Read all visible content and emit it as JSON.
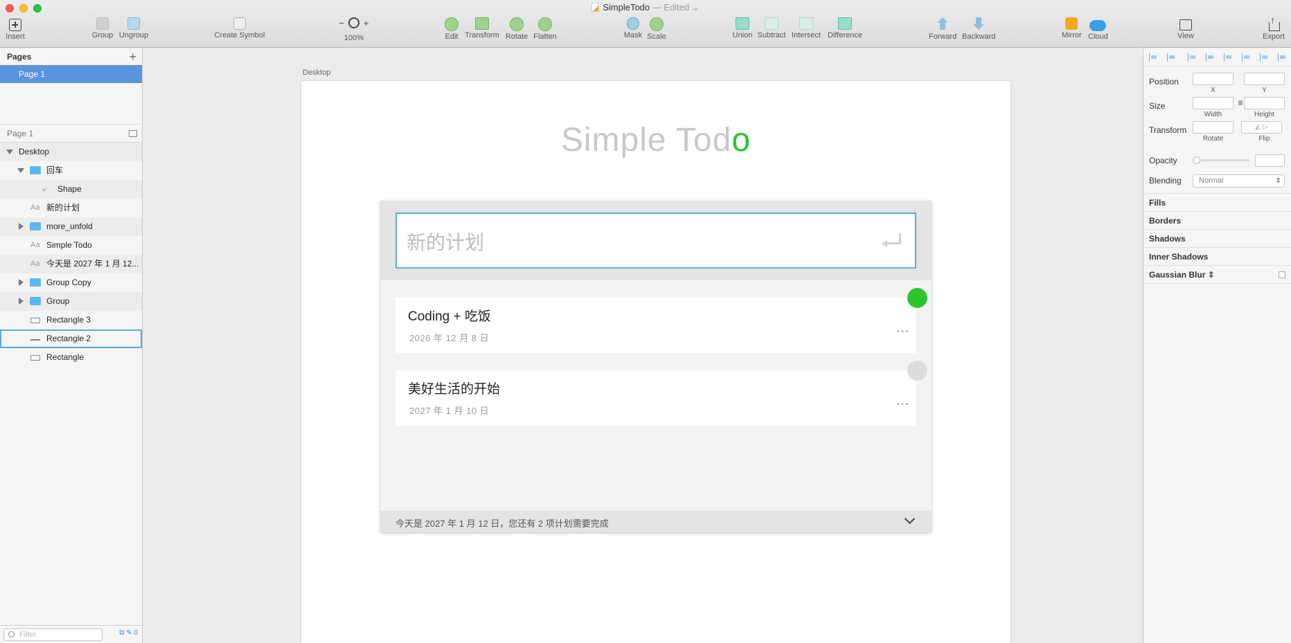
{
  "window": {
    "title": "SimpleTodo",
    "edited": "— Edited ⌄"
  },
  "toolbar": {
    "insert": "Insert",
    "group": "Group",
    "ungroup": "Ungroup",
    "create_symbol": "Create Symbol",
    "zoom_minus": "−",
    "zoom_plus": "+",
    "zoom_value": "100%",
    "edit": "Edit",
    "transform": "Transform",
    "rotate": "Rotate",
    "flatten": "Flatten",
    "mask": "Mask",
    "scale": "Scale",
    "union": "Union",
    "subtract": "Subtract",
    "intersect": "Intersect",
    "difference": "Difference",
    "forward": "Forward",
    "backward": "Backward",
    "mirror": "Mirror",
    "cloud": "Cloud",
    "view": "View",
    "export": "Export"
  },
  "sidebar": {
    "pages_header": "Pages",
    "add_page": "+",
    "pages": [
      "Page 1"
    ],
    "layers_header": "Page 1",
    "layers": [
      {
        "name": "Desktop"
      },
      {
        "name": "回车"
      },
      {
        "name": "Shape"
      },
      {
        "name": "新的计划"
      },
      {
        "name": "more_unfold"
      },
      {
        "name": "Simple Todo"
      },
      {
        "name": "今天是 2027 年 1 月 12..."
      },
      {
        "name": "Group Copy"
      },
      {
        "name": "Group"
      },
      {
        "name": "Rectangle 3"
      },
      {
        "name": "Rectangle 2"
      },
      {
        "name": "Rectangle"
      }
    ],
    "layer_text_icon": "Aa",
    "layer_shape_icon": "⤶",
    "filter_placeholder": "Filter",
    "footer_count": "0"
  },
  "canvas": {
    "artboard_label": "Desktop",
    "app_title_main": "Simple Tod",
    "app_title_accent": "o",
    "input_placeholder": "新的计划",
    "todos": [
      {
        "title": "Coding + 吃饭",
        "date": "2026 年 12 月 8 日",
        "more": "···",
        "status": "done"
      },
      {
        "title": "美好生活的开始",
        "date": "2027 年 1 月 10 日",
        "more": "···",
        "status": "pending"
      }
    ],
    "footer_text": "今天是 2027 年 1 月 12 日，您还有 2 项计划需要完成",
    "colors": {
      "accent_green": "#2cc52c",
      "pending_gray": "#dcdcdc",
      "selection_blue": "#5aa9e6"
    }
  },
  "inspector": {
    "position": "Position",
    "x": "X",
    "y": "Y",
    "size": "Size",
    "width": "Width",
    "height": "Height",
    "transform": "Transform",
    "rotate": "Rotate",
    "flip": "Flip",
    "opacity": "Opacity",
    "blending": "Blending",
    "blending_value": "Normal",
    "fills": "Fills",
    "borders": "Borders",
    "shadows": "Shadows",
    "inner_shadows": "Inner Shadows",
    "gaussian_blur": "Gaussian Blur ⇕"
  }
}
